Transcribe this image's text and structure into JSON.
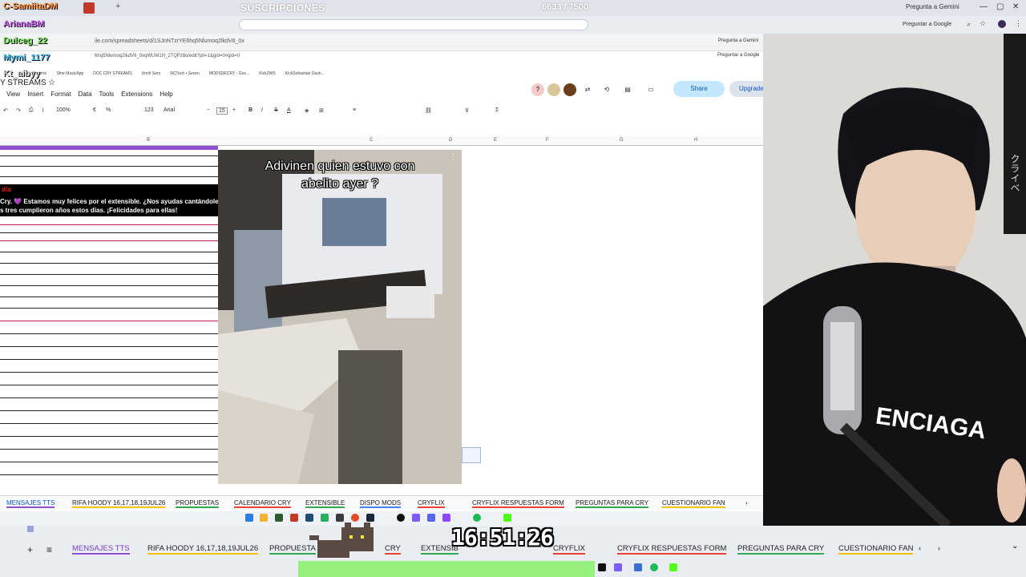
{
  "stream": {
    "banner": "SUSCRIPCIONES",
    "sub_counter": "6633 / 7500",
    "chat_names": [
      {
        "name": "C-SamiitaDM",
        "color": "#ff8a2b"
      },
      {
        "name": "ArianaBM",
        "color": "#d46bff"
      },
      {
        "name": "Dulceg_22",
        "color": "#6fe04a"
      },
      {
        "name": "Mymi_1177",
        "color": "#4ac8ff"
      },
      {
        "name": "Kt_aibyy",
        "color": "#cfcfcf"
      }
    ],
    "timer": "16:51:26"
  },
  "browser": {
    "gemini_label": "Pregunta a Gemini",
    "google_label": "Preguntar a Google",
    "url1": "ile.com/spreadsheets/d/1SJnNTzrYE6hq5Nlumoq2lkdV6_0x",
    "url2": "6hq5Nlumoq2lkdV6_0xqWUM1H_2TQFz8o/edit?pli=1&gid=0#gid=0",
    "bookmarks": [
      "Amazon",
      "Sfmr MusicApp",
      "DOC CRY STREAMS",
      "Umril Sero",
      "RCToch • Seven",
      "MODSDECRY - Goo...",
      "KickZWS",
      "KickSebastian Dash..."
    ]
  },
  "sheets": {
    "doc_title": "Y STREAMS",
    "menu": [
      "View",
      "Insert",
      "Format",
      "Data",
      "Tools",
      "Extensions",
      "Help"
    ],
    "share_label": "Share",
    "upgrade_label": "Upgrade",
    "toolbar": {
      "zoom": "100%",
      "currency": "€",
      "percent": "%",
      "format123": "123",
      "font": "Arial",
      "font_size": "15"
    },
    "columns": [
      "B",
      "C",
      "D",
      "E",
      "F",
      "G",
      "H"
    ],
    "red_title": "dia",
    "message_lines": [
      "Cry. 💜 Estamos muy felices por el extensible. ¿Nos ayudas cantándole",
      "s tres cumplieron años estos días. ¡Felicidades para ellas!"
    ],
    "tabs": [
      "MENSAJES TTS",
      "RIFA HOODY 16,17,18,19JUL26",
      "PROPUESTAS",
      "CALENDARIO CRY",
      "EXTENSIBLE",
      "DISPO MODS",
      "CRYFLIX",
      "CRYFLIX RESPUESTAS FORM",
      "PREGUNTAS PARA CRY",
      "CUESTIONARIO FAN"
    ]
  },
  "video": {
    "caption_line1": "Adivinen quien estuvo con",
    "caption_line2": "abelito ayer ?"
  },
  "webcam": {
    "shirt_text": "ENCIAGA",
    "side_text": "クライベ"
  },
  "bottom_tabs": [
    "MENSAJES TTS",
    "RIFA HOODY 16,17,18,19JUL26",
    "PROPUESTA",
    "CRY",
    "EXTENSIB",
    "CRYFLIX",
    "CRYFLIX RESPUESTAS FORM",
    "PREGUNTAS PARA CRY",
    "CUESTIONARIO FAN"
  ],
  "colors": {
    "accent": "#0b57d0",
    "share_bg": "#c2e7ff",
    "tts_purple": "#8e4fd1"
  }
}
